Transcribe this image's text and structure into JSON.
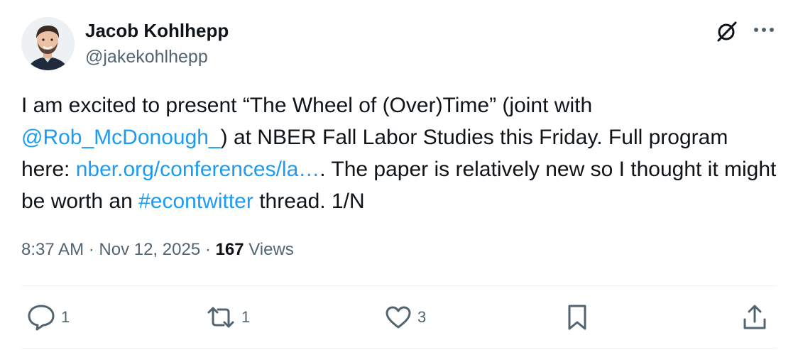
{
  "author": {
    "display_name": "Jacob Kohlhepp",
    "handle": "@jakekohlhepp"
  },
  "tweet": {
    "text_1": "I am excited to present “The Wheel of (Over)Time” (joint with ",
    "mention": "@Rob_McDonough_",
    "text_2": ") at NBER Fall Labor Studies this Friday. Full program here: ",
    "url": "nber.org/conferences/la…",
    "text_3": ". The paper is relatively new so I thought it might be worth an ",
    "hashtag": "#econtwitter",
    "text_4": " thread. 1/N"
  },
  "meta": {
    "time": "8:37 AM",
    "sep1": " · ",
    "date": "Nov 12, 2025",
    "sep2": " · ",
    "views_count": "167",
    "views_label": " Views"
  },
  "actions": {
    "reply_count": "1",
    "retweet_count": "1",
    "like_count": "3"
  },
  "icons": {
    "grok": "grok-icon",
    "more": "more-icon",
    "reply": "reply-icon",
    "retweet": "retweet-icon",
    "like": "heart-icon",
    "bookmark": "bookmark-icon",
    "share": "share-icon"
  },
  "colors": {
    "link": "#1d9bf0",
    "secondary_text": "#536471",
    "primary_text": "#0f1419"
  }
}
